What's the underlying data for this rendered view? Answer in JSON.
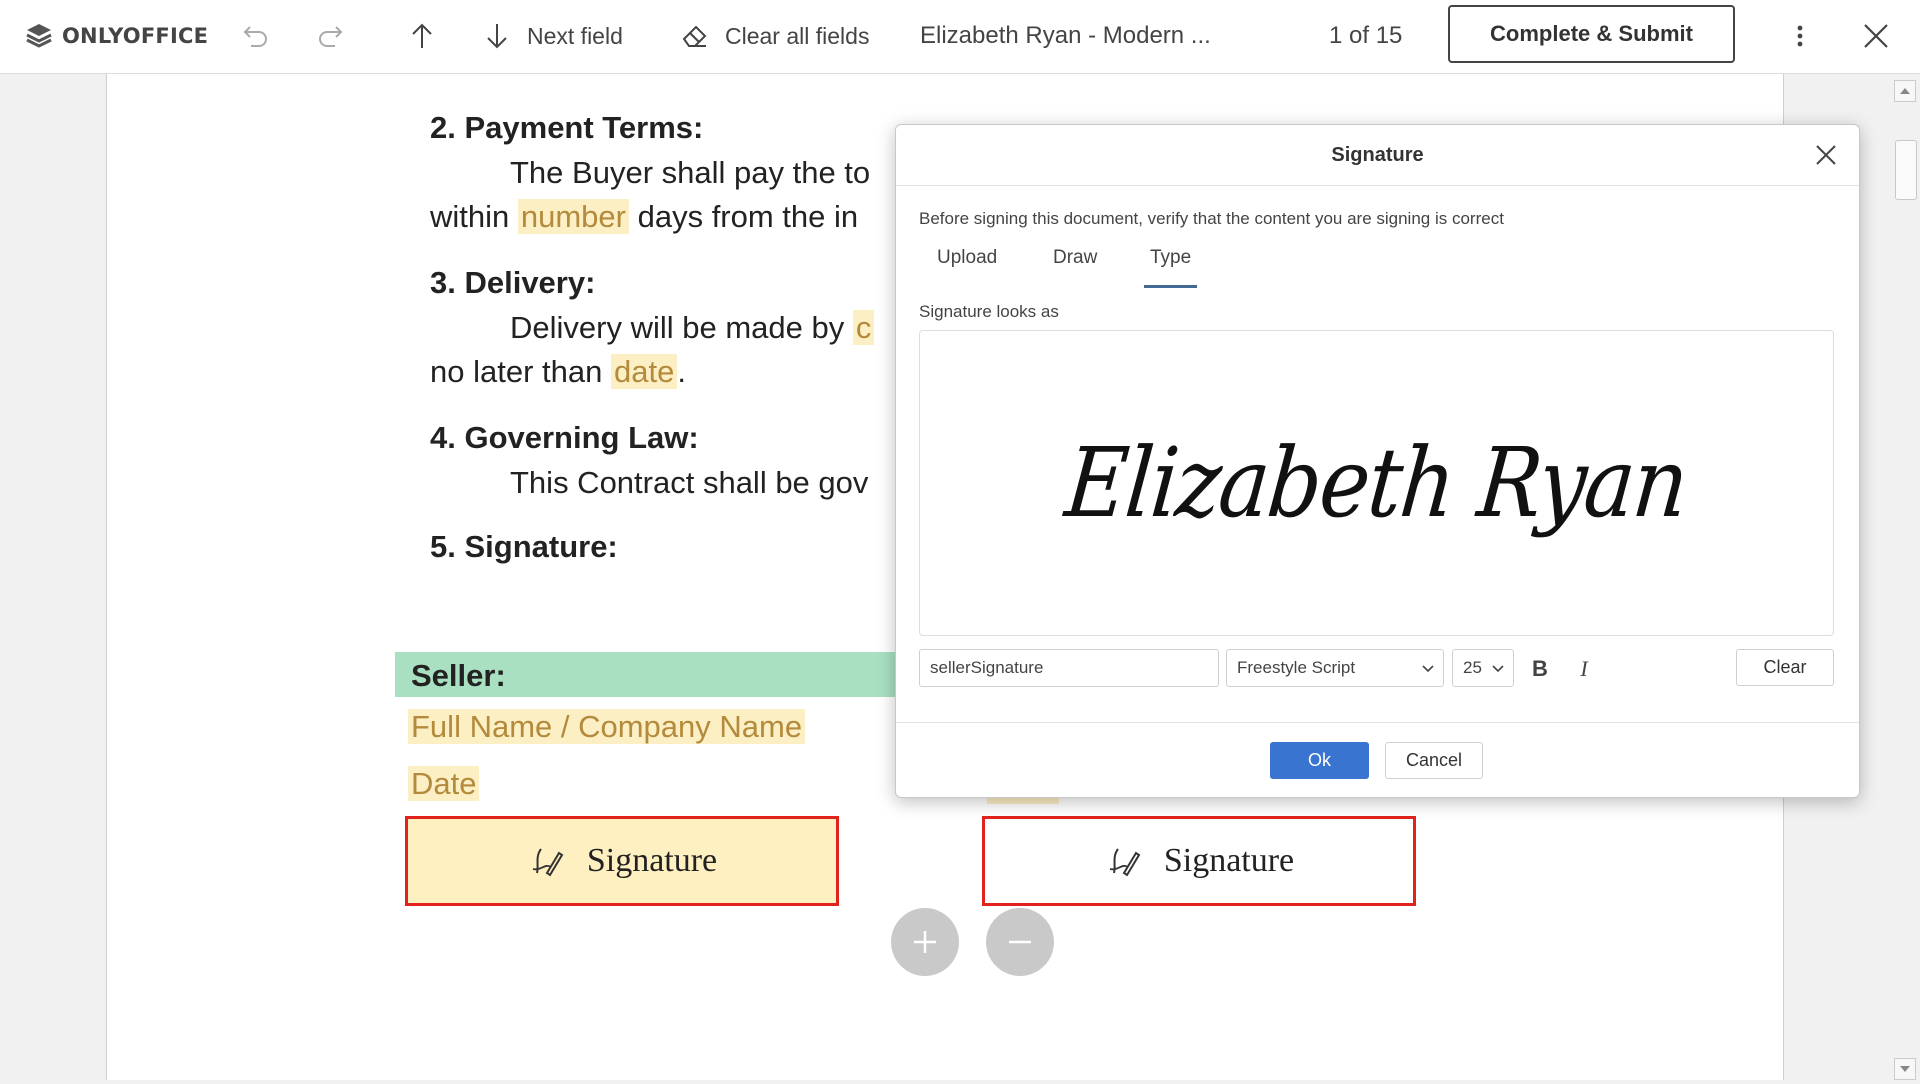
{
  "toolbar": {
    "brand": "ONLYOFFICE",
    "next_field": "Next field",
    "clear_all": "Clear all fields",
    "doc_title": "Elizabeth Ryan - Modern ...",
    "page_indicator": "1 of 15",
    "submit": "Complete & Submit"
  },
  "document": {
    "s2_heading": "2. Payment Terms:",
    "s2_line1": "The Buyer shall pay the to",
    "s2_line2_a": "within ",
    "s2_line2_field": "number",
    "s2_line2_b": " days from the in",
    "s3_heading": "3. Delivery:",
    "s3_line1_a": "Delivery will be made by ",
    "s3_line1_field": "c",
    "s3_line2_a": "no later than ",
    "s3_line2_field": "date",
    "s3_line2_b": ".",
    "s4_heading": "4. Governing Law:",
    "s4_line1": "This Contract shall be gov",
    "s5_heading": "5. Signature:",
    "seller_label": "Seller:",
    "seller_name_field": "Full Name / Company Name",
    "seller_date_field": "Date",
    "sig_field_1": "Signature",
    "sig_field_2": "Signature"
  },
  "dialog": {
    "title": "Signature",
    "instruction": "Before signing this document, verify that the content you are signing is correct",
    "tabs": [
      "Upload",
      "Draw",
      "Type"
    ],
    "active_tab": "Type",
    "preview_label": "Signature looks as",
    "signature_text": "Elizabeth Ryan",
    "name_input_value": "sellerSignature",
    "font_select": "Freestyle Script",
    "size_select": "25",
    "bold": "B",
    "italic": "I",
    "clear": "Clear",
    "ok": "Ok",
    "cancel": "Cancel"
  },
  "colors": {
    "accent": "#3a74d1",
    "field_highlight": "#fcefc4",
    "required_border": "#e0241d",
    "seller_bar": "#a8e0c1"
  }
}
